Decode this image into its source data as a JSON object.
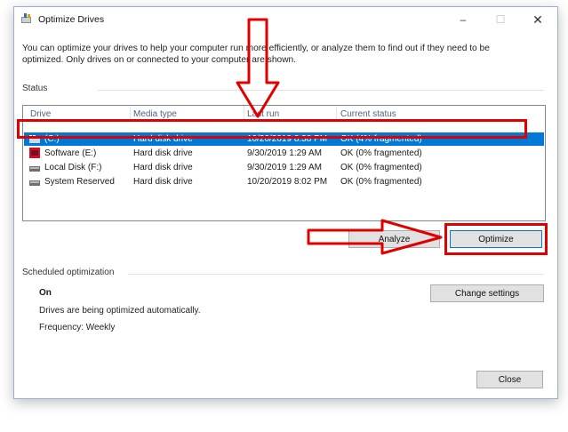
{
  "window": {
    "title": "Optimize Drives",
    "minimize_icon": "minimize-icon",
    "maximize_icon": "maximize-icon",
    "close_icon": "close-icon"
  },
  "description": "You can optimize your drives to help your computer run more efficiently, or analyze them to find out if they need to be optimized. Only drives on or connected to your computer are shown.",
  "status": {
    "label": "Status",
    "columns": [
      "Drive",
      "Media type",
      "Last run",
      "Current status"
    ],
    "rows": [
      {
        "drive": "(C:)",
        "media": "Hard disk drive",
        "last_run": "10/20/2019 8:38 PM",
        "status": "OK (4% fragmented)",
        "icon": "windows-drive-icon",
        "selected": true
      },
      {
        "drive": "Software (E:)",
        "media": "Hard disk drive",
        "last_run": "9/30/2019 1:29 AM",
        "status": "OK (0% fragmented)",
        "icon": "software-drive-icon",
        "selected": false
      },
      {
        "drive": "Local Disk (F:)",
        "media": "Hard disk drive",
        "last_run": "9/30/2019 1:29 AM",
        "status": "OK (0% fragmented)",
        "icon": "drive-icon",
        "selected": false
      },
      {
        "drive": "System Reserved",
        "media": "Hard disk drive",
        "last_run": "10/20/2019 8:02 PM",
        "status": "OK (0% fragmented)",
        "icon": "drive-icon",
        "selected": false
      }
    ]
  },
  "actions": {
    "analyze_label": "Analyze",
    "optimize_label": "Optimize"
  },
  "scheduled": {
    "label": "Scheduled optimization",
    "state": "On",
    "detail": "Drives are being optimized automatically.",
    "frequency": "Frequency: Weekly",
    "change_label": "Change settings"
  },
  "footer": {
    "close_label": "Close"
  },
  "colors": {
    "selection": "#0078d7",
    "annotation": "#e00000"
  }
}
